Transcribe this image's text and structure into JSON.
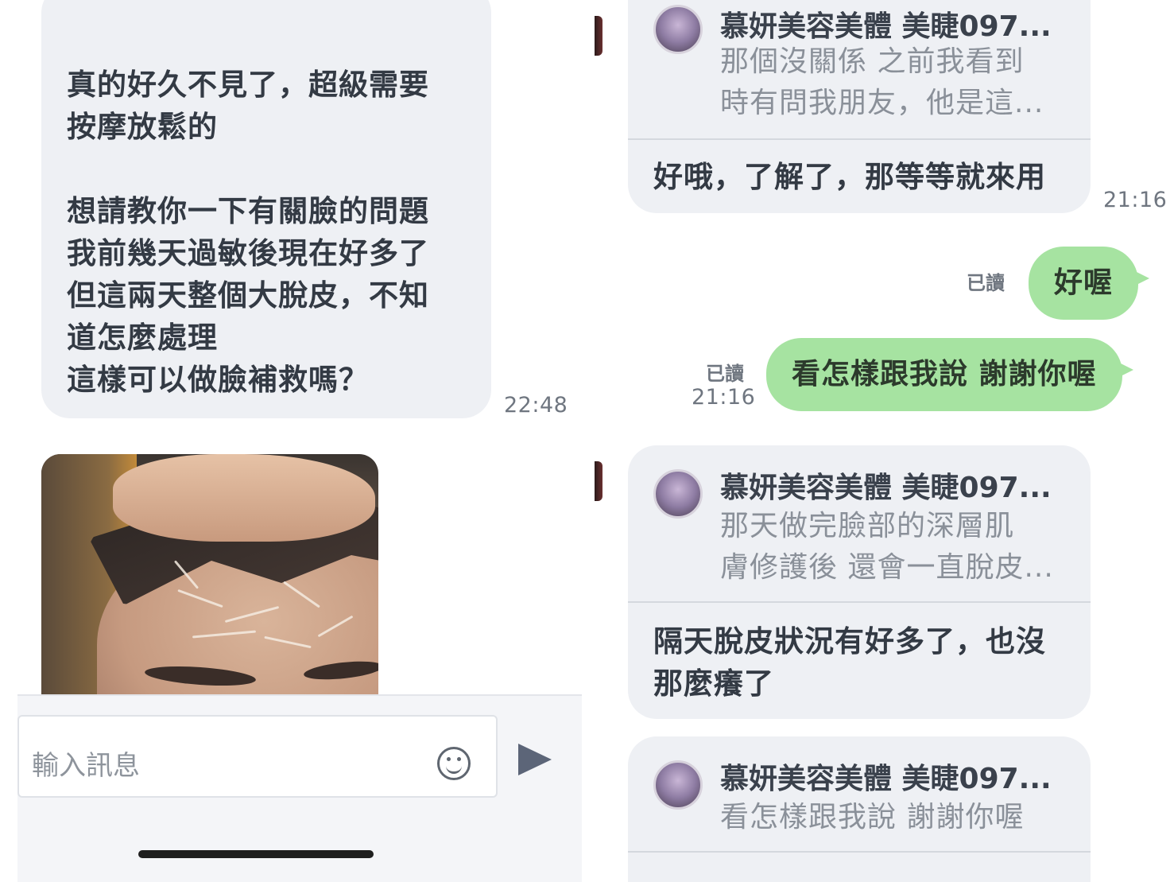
{
  "left": {
    "top_message": {
      "text": "真的好久不見了，超級需要\n按摩放鬆的\n\n想請教你一下有關臉的問題\n我前幾天過敏後現在好多了\n但這兩天整個大脫皮，不知\n道怎麼處理\n這樣可以做臉補救嗎？",
      "time": "22:48"
    },
    "input": {
      "placeholder": "輸入訊息",
      "emoji_icon": "smiley-icon",
      "send_icon": "send-icon"
    }
  },
  "right": {
    "quoted_1": {
      "sender": "慕妍美容美體 美睫097...",
      "preview": "那個沒關係 之前我看到\n時有問我朋友，他是這...",
      "reply": "好哦，了解了，那等等就來用",
      "time": "21:16"
    },
    "out_1": {
      "read": "已讀",
      "text": "好喔"
    },
    "out_2": {
      "read": "已讀",
      "time": "21:16",
      "text": "看怎樣跟我說 謝謝你喔"
    },
    "quoted_2": {
      "sender": "慕妍美容美體 美睫097...",
      "preview": "那天做完臉部的深層肌\n膚修護後 還會一直脫皮...",
      "reply": "隔天脫皮狀況有好多了，也沒\n那麼癢了"
    },
    "quoted_3": {
      "sender": "慕妍美容美體 美睫097...",
      "preview": "看怎樣跟我說 謝謝你喔"
    }
  }
}
